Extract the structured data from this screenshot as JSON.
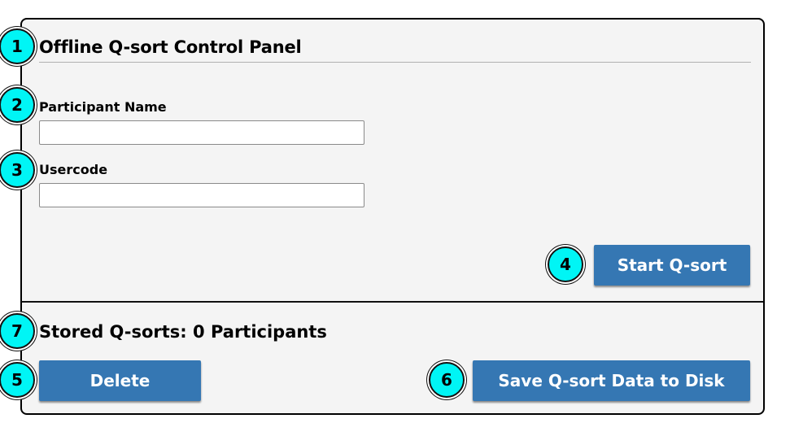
{
  "panel": {
    "title": "Offline Q-sort Control Panel",
    "participant_label": "Participant Name",
    "participant_value": "",
    "usercode_label": "Usercode",
    "usercode_value": "",
    "start_button": "Start Q-sort"
  },
  "storage": {
    "stored_text": "Stored Q-sorts: 0 Participants",
    "delete_button": "Delete",
    "save_button": "Save Q-sort Data to Disk"
  },
  "markers": [
    "1",
    "2",
    "3",
    "4",
    "5",
    "6",
    "7"
  ],
  "colors": {
    "button": "#3577b3",
    "marker": "#00f5f5",
    "panel_bg": "#f4f4f4"
  }
}
